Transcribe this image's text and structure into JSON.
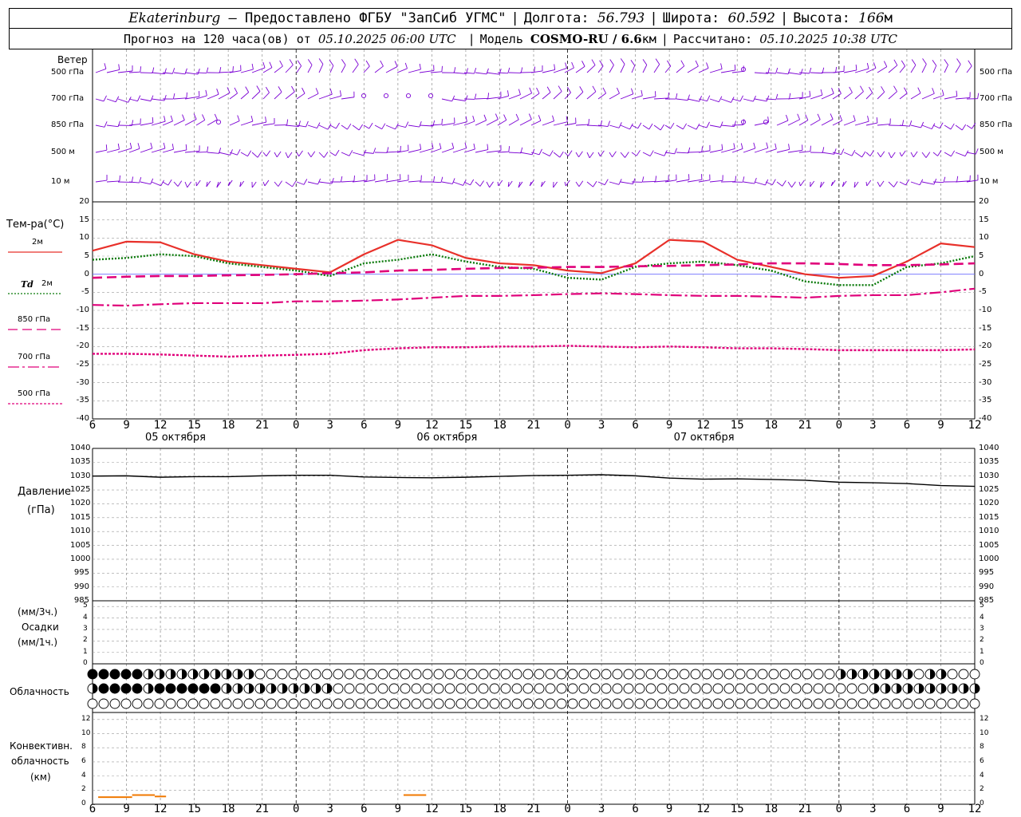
{
  "header": {
    "location": "Ekaterinburg",
    "dash": " – ",
    "provider": "Предоставлено ФГБУ \"ЗапСиб УГМС\"",
    "lon_label": "Долгота:",
    "lon_value": "56.793",
    "lat_label": "Широта:",
    "lat_value": "60.592",
    "alt_label": "Высота:",
    "alt_value": "166",
    "alt_unit": "м",
    "forecast_label": "Прогноз на 120 часа(ов) от",
    "forecast_from": "05.10.2025 06:00 UTC",
    "model_label": "Модель",
    "model_name": "COSMO-RU / 6.6",
    "model_unit": "км",
    "calc_label": "Рассчитано:",
    "calc_time": "05.10.2025 10:38 UTC"
  },
  "colors": {
    "wind": "#7b00d4",
    "t2m": "#e8302a",
    "td2m": "#0a7a0a",
    "t850": "#e0007a",
    "t700": "#e0007a",
    "t500": "#e0007a",
    "pressure": "#000000",
    "conv": "#f07800",
    "grid": "#9a9a9a"
  },
  "wind_panel": {
    "title": "Ветер",
    "levels": [
      "500 гПа",
      "700 гПа",
      "850 гПа",
      "500 м",
      "10  м"
    ]
  },
  "temp_panel": {
    "title": "Тем-ра(°C)",
    "legend": [
      {
        "label": "2м",
        "style": "solid"
      },
      {
        "label": "2м",
        "prefix": "Td",
        "style": "dotted"
      },
      {
        "label": "850 гПа",
        "style": "dashed"
      },
      {
        "label": "700 гПа",
        "style": "dashdot"
      },
      {
        "label": "500 гПа",
        "style": "dot"
      }
    ],
    "y_ticks": [
      "20",
      "15",
      "10",
      "5",
      "0",
      "-5",
      "-10",
      "-15",
      "-20",
      "-25",
      "-30",
      "-35",
      "-40"
    ]
  },
  "time_axis": {
    "hours": [
      "6",
      "9",
      "12",
      "15",
      "18",
      "21",
      "0",
      "3",
      "6",
      "9",
      "12",
      "15",
      "18",
      "21",
      "0",
      "3",
      "6",
      "9",
      "12",
      "15",
      "18",
      "21",
      "0",
      "3",
      "6",
      "9",
      "12"
    ],
    "dates": [
      "05 октября",
      "06 октября",
      "07 октября"
    ]
  },
  "pressure_panel": {
    "title": "Давление",
    "unit": "(гПа)",
    "y_ticks": [
      "1040",
      "1035",
      "1030",
      "1025",
      "1020",
      "1015",
      "1010",
      "1005",
      "1000",
      "995",
      "990",
      "985"
    ]
  },
  "precip_panel": {
    "unit3": "(мм/3ч.)",
    "title": "Осадки",
    "unit1": "(мм/1ч.)",
    "y_ticks": [
      "5",
      "4",
      "3",
      "2",
      "1",
      "0"
    ]
  },
  "cloud_panel": {
    "title": "Облачность"
  },
  "conv_panel": {
    "title1": "Конвективн.",
    "title2": "облачность",
    "unit": "(км)",
    "y_ticks": [
      "12",
      "10",
      "8",
      "6",
      "4",
      "2",
      "0"
    ]
  },
  "chart_data": [
    {
      "type": "line",
      "title": "Тем-ра(°C)",
      "x_hours": [
        6,
        9,
        12,
        15,
        18,
        21,
        24,
        27,
        30,
        33,
        36,
        39,
        42,
        45,
        48,
        51,
        54,
        57,
        60,
        63,
        66,
        69,
        72,
        75,
        78,
        81,
        84
      ],
      "ylim": [
        -40,
        20
      ],
      "series": [
        {
          "name": "2м",
          "values": [
            6.5,
            9,
            8.8,
            5.5,
            3.5,
            2.5,
            1.5,
            0.5,
            5.5,
            9.5,
            8,
            4.5,
            3,
            2.5,
            1,
            0.3,
            3,
            9.5,
            9,
            4,
            2,
            0,
            -1,
            -0.5,
            3.5,
            8.5,
            7.5
          ]
        },
        {
          "name": "Td 2м",
          "values": [
            4,
            4.5,
            5.5,
            5,
            3,
            2,
            1,
            -0.5,
            3,
            4,
            5.5,
            3.5,
            2,
            1.5,
            -1,
            -1.5,
            2,
            3,
            3.5,
            2.5,
            1,
            -2,
            -3,
            -3,
            2,
            3,
            5
          ]
        },
        {
          "name": "850 гПа",
          "values": [
            -1,
            -0.7,
            -0.5,
            -0.5,
            -0.3,
            -0.2,
            0,
            0.3,
            0.5,
            1,
            1.2,
            1.5,
            1.7,
            1.8,
            2,
            2,
            2.2,
            2.3,
            2.5,
            2.7,
            3,
            3,
            2.8,
            2.5,
            2.5,
            2.7,
            3
          ]
        },
        {
          "name": "700 гПа",
          "values": [
            -8.5,
            -8.7,
            -8.3,
            -8,
            -8,
            -8,
            -7.5,
            -7.5,
            -7.3,
            -7,
            -6.5,
            -6,
            -6,
            -5.8,
            -5.5,
            -5.3,
            -5.5,
            -5.8,
            -6,
            -6,
            -6.2,
            -6.5,
            -6,
            -5.8,
            -5.8,
            -5,
            -4
          ]
        },
        {
          "name": "500 гПа",
          "values": [
            -22,
            -22,
            -22.2,
            -22.5,
            -22.8,
            -22.5,
            -22.3,
            -22,
            -21,
            -20.5,
            -20.2,
            -20.2,
            -20,
            -20,
            -19.8,
            -20,
            -20.2,
            -20,
            -20.2,
            -20.5,
            -20.5,
            -20.7,
            -21,
            -21,
            -21,
            -21,
            -20.8
          ]
        }
      ]
    },
    {
      "type": "line",
      "title": "Давление",
      "x_hours": [
        6,
        9,
        12,
        15,
        18,
        21,
        24,
        27,
        30,
        33,
        36,
        39,
        42,
        45,
        48,
        51,
        54,
        57,
        60,
        63,
        66,
        69,
        72,
        75,
        78,
        81,
        84
      ],
      "ylim": [
        985,
        1040
      ],
      "series": [
        {
          "name": "Давление",
          "values": [
            1030,
            1030.1,
            1029.6,
            1029.8,
            1029.8,
            1030.1,
            1030.3,
            1030.3,
            1029.7,
            1029.5,
            1029.4,
            1029.6,
            1029.9,
            1030.2,
            1030.3,
            1030.5,
            1030.1,
            1029.3,
            1028.9,
            1029,
            1028.8,
            1028.5,
            1027.8,
            1027.6,
            1027.3,
            1026.6,
            1026.3
          ]
        }
      ]
    },
    {
      "type": "bar",
      "title": "Конвективн. облачность",
      "ylim": [
        0,
        13
      ],
      "segments": [
        {
          "from": 6.5,
          "to": 9.5,
          "value": 1.0
        },
        {
          "from": 9.5,
          "to": 11.5,
          "value": 1.3
        },
        {
          "from": 11.5,
          "to": 12.5,
          "value": 1.1
        },
        {
          "from": 33.5,
          "to": 35.5,
          "value": 1.3
        }
      ]
    }
  ]
}
